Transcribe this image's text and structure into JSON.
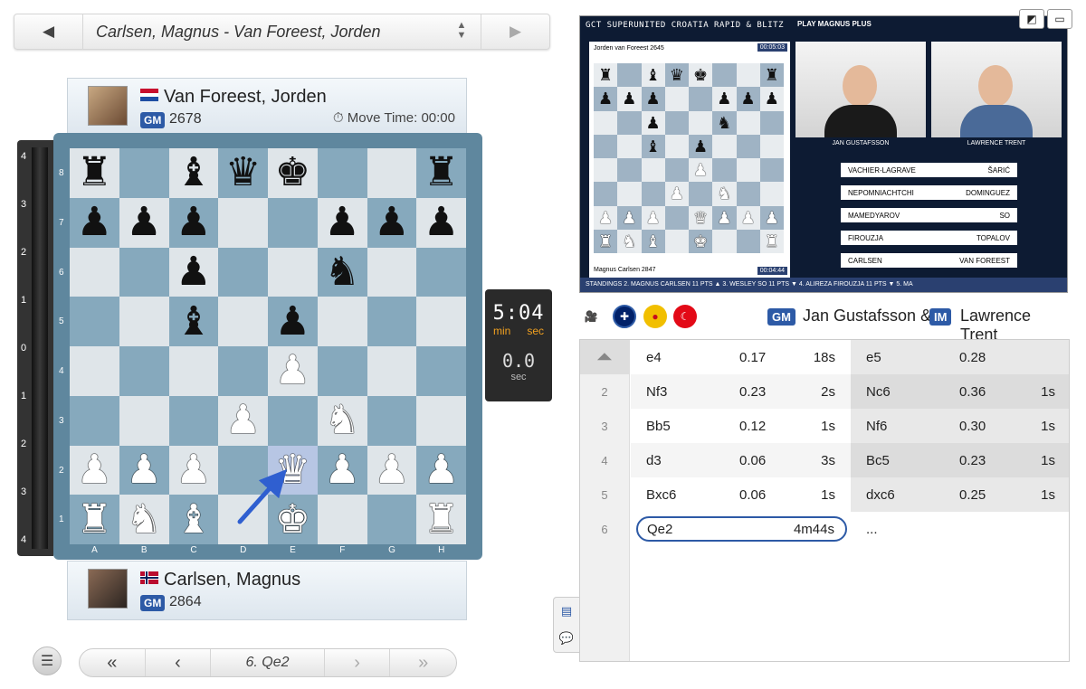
{
  "game_selector": {
    "title": "Carlsen, Magnus - Van Foreest, Jorden",
    "prev_icon": "triangle-left-icon",
    "next_icon": "triangle-right-icon"
  },
  "top_player": {
    "name": "Van Foreest, Jorden",
    "title": "GM",
    "rating": "2678",
    "move_time_label": "Move Time: 00:00",
    "flag": "netherlands"
  },
  "bottom_player": {
    "name": "Carlsen, Magnus",
    "title": "GM",
    "rating": "2864",
    "flag": "norway"
  },
  "eval_bar": {
    "ticks": [
      "4",
      "3",
      "2",
      "1",
      "0",
      "1",
      "2",
      "3",
      "4"
    ]
  },
  "board": {
    "files": [
      "A",
      "B",
      "C",
      "D",
      "E",
      "F",
      "G",
      "H"
    ],
    "ranks": [
      "8",
      "7",
      "6",
      "5",
      "4",
      "3",
      "2",
      "1"
    ],
    "position": [
      [
        "bR",
        "",
        "bB",
        "bQ",
        "bK",
        "",
        "",
        "bR"
      ],
      [
        "bP",
        "bP",
        "bP",
        "",
        "",
        "bP",
        "bP",
        "bP"
      ],
      [
        "",
        "",
        "bP",
        "",
        "",
        "bN",
        "",
        ""
      ],
      [
        "",
        "",
        "bB",
        "",
        "bP",
        "",
        "",
        ""
      ],
      [
        "",
        "",
        "",
        "",
        "wP",
        "",
        "",
        ""
      ],
      [
        "",
        "",
        "",
        "wP",
        "",
        "wN",
        "",
        ""
      ],
      [
        "wP",
        "wP",
        "wP",
        "",
        "wQ",
        "wP",
        "wP",
        "wP"
      ],
      [
        "wR",
        "wN",
        "wB",
        "",
        "wK",
        "",
        "",
        "wR"
      ]
    ],
    "last_move": {
      "from": "d1",
      "to": "e2"
    }
  },
  "clock": {
    "time": "5:04",
    "min_label": "min",
    "sec_label": "sec",
    "secs": "0.0",
    "secs_label": "sec"
  },
  "move_nav": {
    "current": "6. Qe2",
    "menu_icon": "hamburger-icon"
  },
  "video": {
    "header": "GCT SUPERUNITED CROATIA RAPID & BLITZ",
    "promo": "PLAY MAGNUS PLUS",
    "board_top_player": "Jorden van Foreest 2645",
    "board_top_clock": "00:05:03",
    "board_bottom_player": "Magnus Carlsen 2847",
    "board_bottom_clock": "00:04:44",
    "cam1": "JAN GUSTAFSSON",
    "cam2": "LAWRENCE TRENT",
    "pairings": [
      [
        "VACHIER-LAGRAVE",
        "ŠARIĆ"
      ],
      [
        "NEPOMNIACHTCHI",
        "DOMINGUEZ"
      ],
      [
        "MAMEDYAROV",
        "SO"
      ],
      [
        "FIROUZJA",
        "TOPALOV"
      ],
      [
        "CARLSEN",
        "VAN FOREEST"
      ]
    ],
    "ticker": "STANDINGS   2. MAGNUS CARLSEN  11 PTS ▲   3. WESLEY SO  11 PTS ▼   4. ALIREZA FIROUZJA  11 PTS ▼   5. MA"
  },
  "commentary": {
    "c1_title": "GM",
    "c1_name": "Jan Gustafsson &",
    "c2_title": "IM",
    "c2_name": "Lawrence Trent"
  },
  "moves": [
    {
      "n": "",
      "w": "e4",
      "we": "0.17",
      "wt": "18s",
      "b": "e5",
      "be": "0.28",
      "bt": ""
    },
    {
      "n": "2",
      "w": "Nf3",
      "we": "0.23",
      "wt": "2s",
      "b": "Nc6",
      "be": "0.36",
      "bt": "1s"
    },
    {
      "n": "3",
      "w": "Bb5",
      "we": "0.12",
      "wt": "1s",
      "b": "Nf6",
      "be": "0.30",
      "bt": "1s"
    },
    {
      "n": "4",
      "w": "d3",
      "we": "0.06",
      "wt": "3s",
      "b": "Bc5",
      "be": "0.23",
      "bt": "1s"
    },
    {
      "n": "5",
      "w": "Bxc6",
      "we": "0.06",
      "wt": "1s",
      "b": "dxc6",
      "be": "0.25",
      "bt": "1s"
    }
  ],
  "current_move": {
    "n": "6",
    "w": "Qe2",
    "wt": "4m44s",
    "b": "..."
  }
}
